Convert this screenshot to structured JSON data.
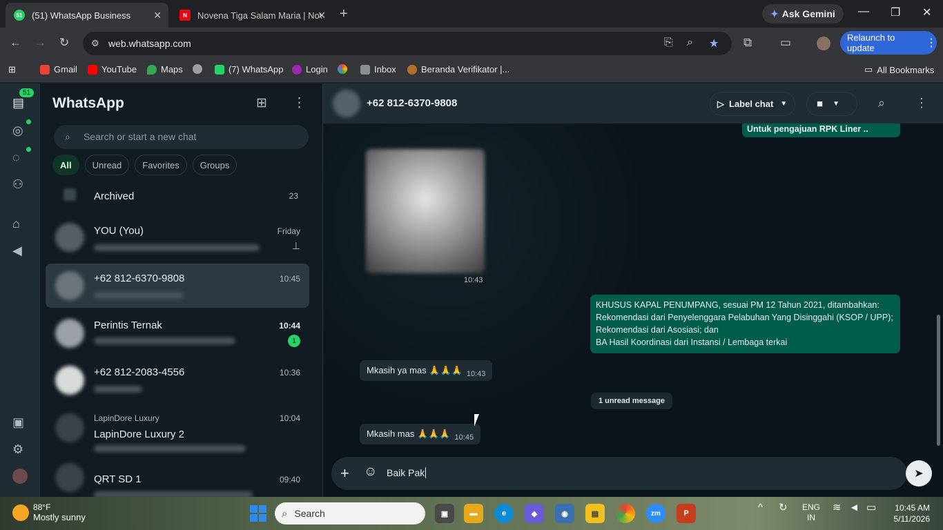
{
  "browser": {
    "tabs": [
      {
        "title": "(51) WhatsApp Business",
        "favicon": "51",
        "active": true
      },
      {
        "title": "Novena Tiga Salam Maria | Nov",
        "favicon": "N",
        "active": false
      }
    ],
    "gemini_label": "Ask Gemini",
    "url": "web.whatsapp.com",
    "relaunch_label": "Relaunch to update",
    "bookmarks": [
      "Gmail",
      "YouTube",
      "Maps",
      "(7) WhatsApp",
      "Login",
      "Inbox",
      "Beranda Verifikator |..."
    ],
    "all_bookmarks": "All Bookmarks"
  },
  "rail": {
    "badge": "51"
  },
  "sidebar": {
    "title": "WhatsApp",
    "search_placeholder": "Search or start a new chat",
    "filters": [
      "All",
      "Unread",
      "Favorites",
      "Groups"
    ],
    "archived": {
      "label": "Archived",
      "count": "23"
    },
    "chats": [
      {
        "name": "YOU (You)",
        "time": "Friday",
        "pinned": true
      },
      {
        "name": "+62 812-6370-9808",
        "time": "10:45",
        "selected": true
      },
      {
        "name": "Perintis Ternak",
        "time": "10:44",
        "unread": "1"
      },
      {
        "name": "+62 812-2083-4556",
        "time": "10:36"
      },
      {
        "sender": "LapinDore Luxury",
        "name": "LapinDore Luxury 2",
        "time": "10:04"
      },
      {
        "name": "QRT SD 1",
        "time": "09:40"
      }
    ]
  },
  "conversation": {
    "contact": "+62 812-6370-9808",
    "label_button": "Label chat",
    "messages": {
      "top_out": "Untuk pengajuan RPK Liner ..",
      "image_time": "10:43",
      "long_out": [
        "KHUSUS KAPAL PENUMPANG, sesuai PM 12 Tahun 2021, ditambahkan:",
        "Rekomendasi dari Penyelenggara Pelabuhan Yang Disinggahi (KSOP / UPP);",
        "Rekomendasi dari Asosiasi; dan",
        "BA Hasil Koordinasi dari Instansi / Lembaga terkai"
      ],
      "in1_text": "Mkasih ya mas 🙏🙏🙏",
      "in1_time": "10:43",
      "unread_divider": "1 unread message",
      "in2_text": "Mkasih mas 🙏🙏🙏",
      "in2_time": "10:45"
    },
    "composer_text": "Baik Pak"
  },
  "taskbar": {
    "weather_temp": "88°F",
    "weather_desc": "Mostly sunny",
    "search_label": "Search",
    "lang": "ENG",
    "region": "IN",
    "time": "10:45 AM",
    "date": "5/11/2026"
  }
}
